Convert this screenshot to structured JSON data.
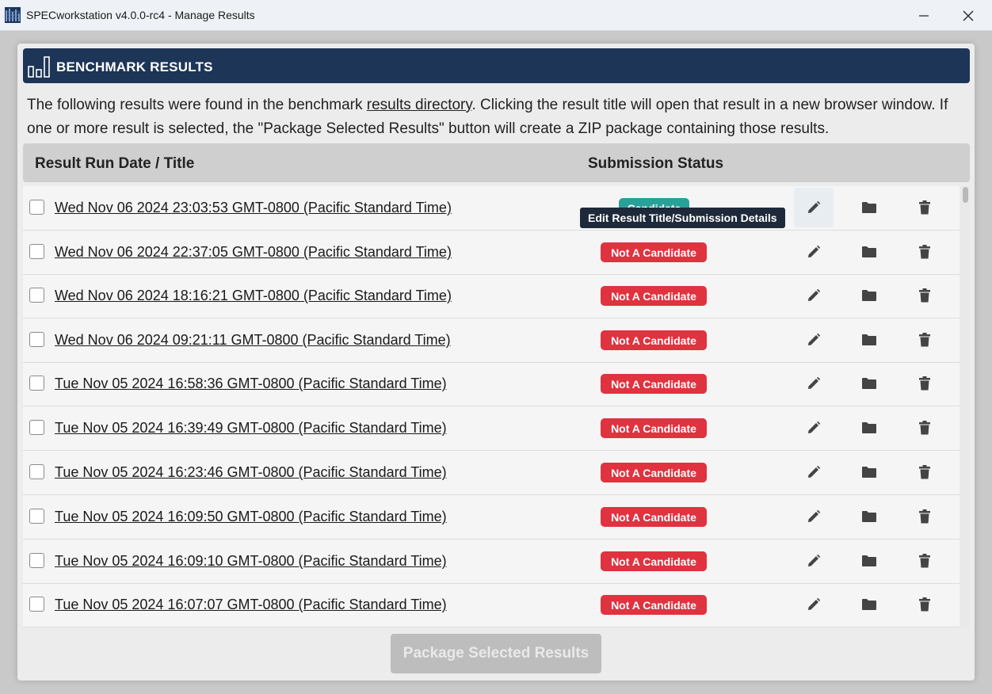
{
  "window": {
    "title": "SPECworkstation v4.0.0-rc4 - Manage Results",
    "min_icon": "minimize-icon",
    "close_icon": "close-icon"
  },
  "header": {
    "title": "BENCHMARK RESULTS",
    "icon": "bar-chart-icon",
    "color": "#1d3557"
  },
  "intro": {
    "text_before": "The following results were found in the benchmark ",
    "link": "results directory",
    "text_after": ". Clicking the result title will open that result in a new browser window. If one or more result is selected, the \"Package Selected Results\" button will create a ZIP package containing those results."
  },
  "table": {
    "col_title": "Result Run Date / Title",
    "col_status": "Submission Status",
    "rows": [
      {
        "title": "Wed Nov 06 2024 23:03:53 GMT-0800 (Pacific Standard Time)",
        "status": "Candidate",
        "status_kind": "cand"
      },
      {
        "title": "Wed Nov 06 2024 22:37:05 GMT-0800 (Pacific Standard Time)",
        "status": "Not A Candidate",
        "status_kind": "nac"
      },
      {
        "title": "Wed Nov 06 2024 18:16:21 GMT-0800 (Pacific Standard Time)",
        "status": "Not A Candidate",
        "status_kind": "nac"
      },
      {
        "title": "Wed Nov 06 2024 09:21:11 GMT-0800 (Pacific Standard Time)",
        "status": "Not A Candidate",
        "status_kind": "nac"
      },
      {
        "title": "Tue Nov 05 2024 16:58:36 GMT-0800 (Pacific Standard Time)",
        "status": "Not A Candidate",
        "status_kind": "nac"
      },
      {
        "title": "Tue Nov 05 2024 16:39:49 GMT-0800 (Pacific Standard Time)",
        "status": "Not A Candidate",
        "status_kind": "nac"
      },
      {
        "title": "Tue Nov 05 2024 16:23:46 GMT-0800 (Pacific Standard Time)",
        "status": "Not A Candidate",
        "status_kind": "nac"
      },
      {
        "title": "Tue Nov 05 2024 16:09:50 GMT-0800 (Pacific Standard Time)",
        "status": "Not A Candidate",
        "status_kind": "nac"
      },
      {
        "title": "Tue Nov 05 2024 16:09:10 GMT-0800 (Pacific Standard Time)",
        "status": "Not A Candidate",
        "status_kind": "nac"
      },
      {
        "title": "Tue Nov 05 2024 16:07:07 GMT-0800 (Pacific Standard Time)",
        "status": "Not A Candidate",
        "status_kind": "nac"
      }
    ],
    "action_icons": [
      "pencil-icon",
      "folder-icon",
      "trash-icon"
    ]
  },
  "tooltip": "Edit Result Title/Submission Details",
  "package_button": "Package Selected Results",
  "colors": {
    "not_candidate": "#e0323f",
    "candidate": "#2aa198"
  }
}
